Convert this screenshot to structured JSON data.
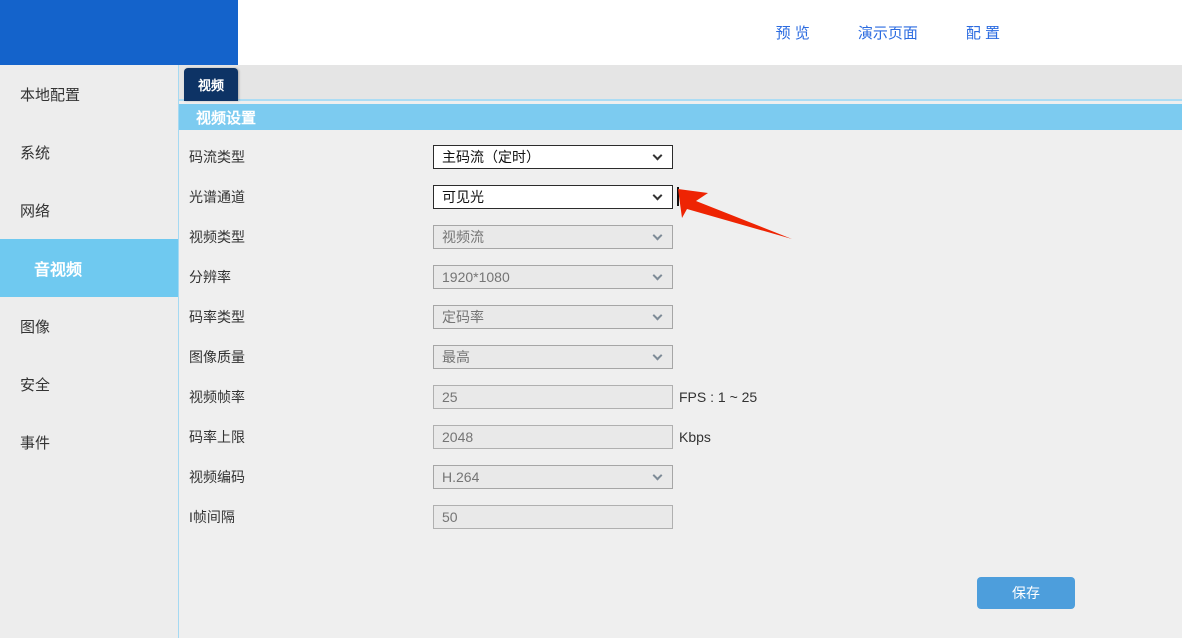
{
  "header": {
    "nav": [
      {
        "label": "预 览"
      },
      {
        "label": "演示页面"
      },
      {
        "label": "配 置"
      }
    ]
  },
  "sidebar": {
    "items": [
      {
        "key": "local-config",
        "label": "本地配置",
        "active": false
      },
      {
        "key": "system",
        "label": "系统",
        "active": false
      },
      {
        "key": "network",
        "label": "网络",
        "active": false
      },
      {
        "key": "audio-video",
        "label": "音视频",
        "active": true
      },
      {
        "key": "image",
        "label": "图像",
        "active": false
      },
      {
        "key": "security",
        "label": "安全",
        "active": false
      },
      {
        "key": "event",
        "label": "事件",
        "active": false
      }
    ]
  },
  "tabs": [
    {
      "key": "video",
      "label": "视频",
      "active": true
    }
  ],
  "section": {
    "title": "视频设置"
  },
  "form": {
    "rows": [
      {
        "key": "stream-type",
        "label": "码流类型",
        "type": "select",
        "value": "主码流（定时）",
        "enabled": true,
        "hint": ""
      },
      {
        "key": "spectral-channel",
        "label": "光谱通道",
        "type": "select",
        "value": "可见光",
        "enabled": true,
        "hint": ""
      },
      {
        "key": "video-type",
        "label": "视频类型",
        "type": "select",
        "value": "视频流",
        "enabled": false,
        "hint": ""
      },
      {
        "key": "resolution",
        "label": "分辨率",
        "type": "select",
        "value": "1920*1080",
        "enabled": false,
        "hint": ""
      },
      {
        "key": "bitrate-type",
        "label": "码率类型",
        "type": "select",
        "value": "定码率",
        "enabled": false,
        "hint": ""
      },
      {
        "key": "image-quality",
        "label": "图像质量",
        "type": "select",
        "value": "最高",
        "enabled": false,
        "hint": ""
      },
      {
        "key": "frame-rate",
        "label": "视频帧率",
        "type": "input",
        "value": "25",
        "enabled": false,
        "hint": "FPS : 1 ~ 25"
      },
      {
        "key": "bitrate-limit",
        "label": "码率上限",
        "type": "input",
        "value": "2048",
        "enabled": false,
        "hint": "Kbps"
      },
      {
        "key": "video-encoding",
        "label": "视频编码",
        "type": "select",
        "value": "H.264",
        "enabled": false,
        "hint": ""
      },
      {
        "key": "i-frame-interval",
        "label": "I帧间隔",
        "type": "input",
        "value": "50",
        "enabled": false,
        "hint": ""
      }
    ],
    "save_label": "保存"
  },
  "colors": {
    "logo_blue": "#1463cb",
    "nav_link_blue": "#2b6be0",
    "tab_navy": "#0d3365",
    "section_header_blue": "#7ccbf0",
    "active_item_blue": "#6fc9f0",
    "save_button_blue": "#4d9edc",
    "annotation_arrow_red": "#ee2403"
  }
}
